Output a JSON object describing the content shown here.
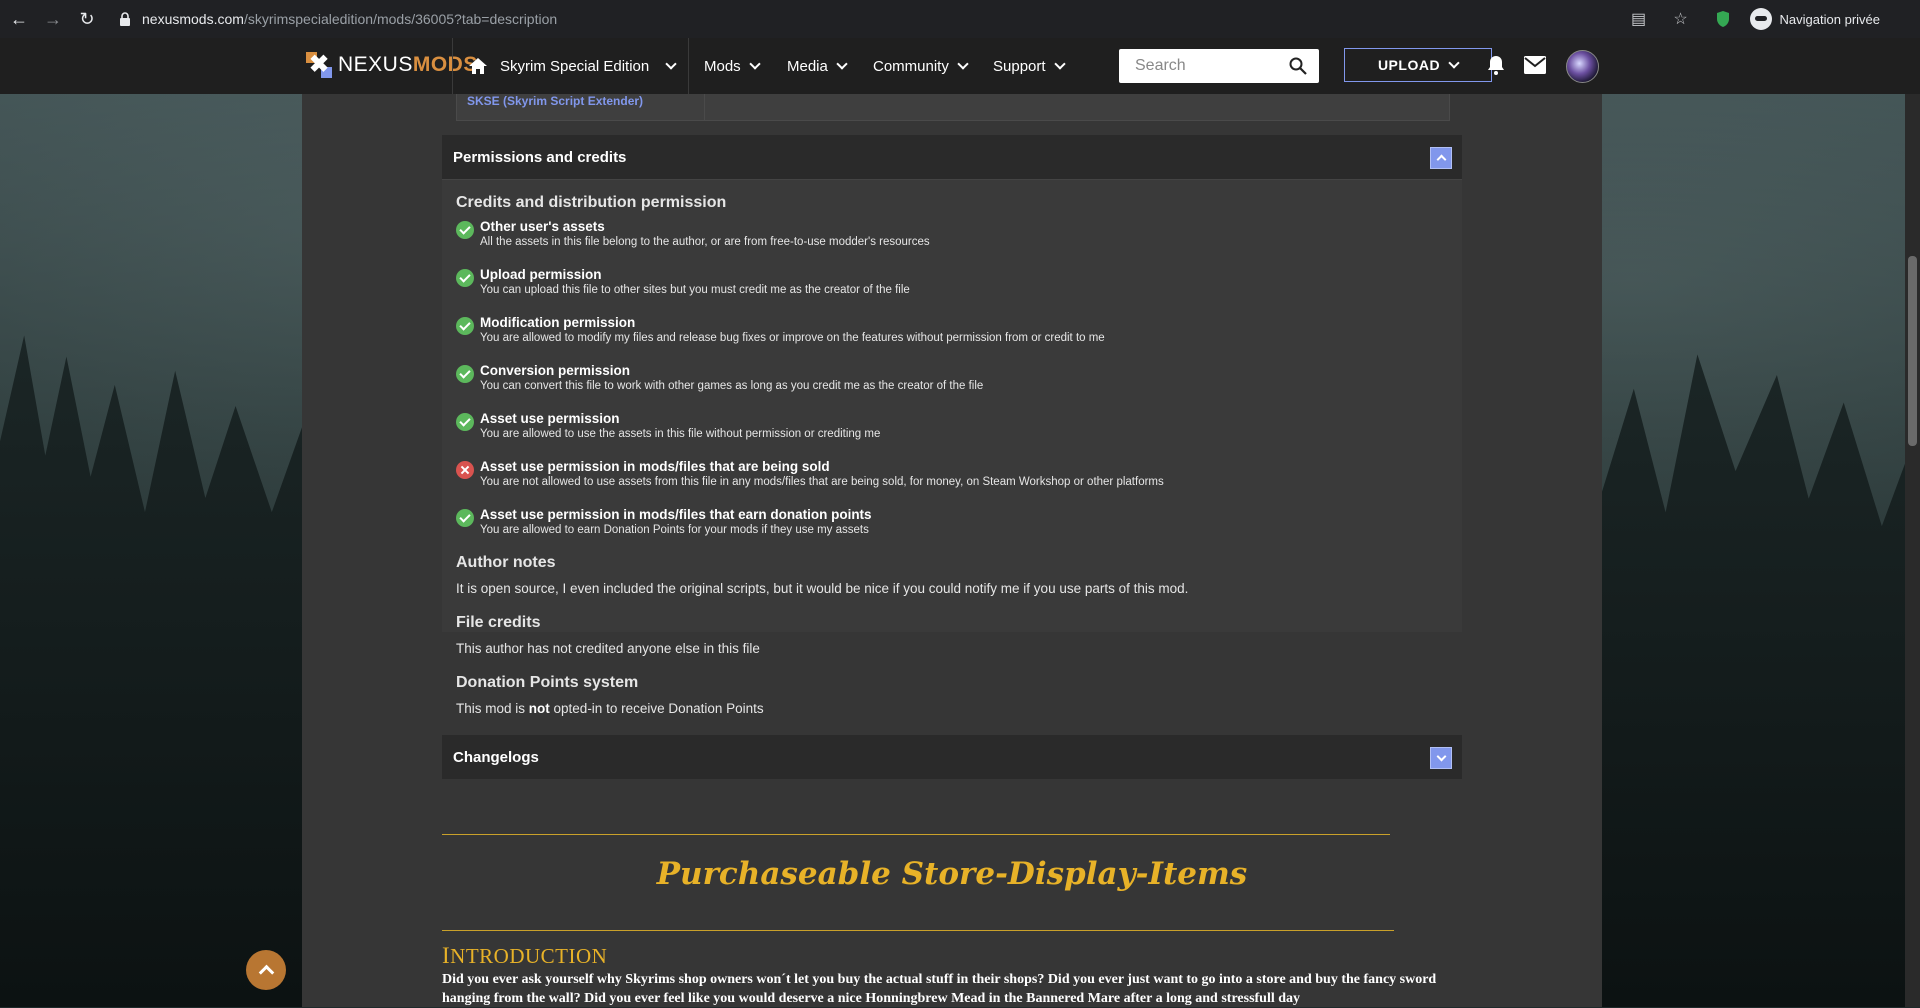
{
  "browser": {
    "url_host": "nexusmods.com",
    "url_path": "/skyrimspecialedition/mods/36005?tab=description",
    "profile_label": "Navigation privée"
  },
  "nav": {
    "logo_part1": "NEXUS",
    "logo_part2": "MODS",
    "game": "Skyrim Special Edition",
    "items": [
      "Mods",
      "Media",
      "Community",
      "Support"
    ],
    "search_placeholder": "Search",
    "upload_label": "UPLOAD"
  },
  "requirements": {
    "link": "SKSE (Skyrim Script Extender)"
  },
  "permissions": {
    "panel_title": "Permissions and credits",
    "credits_heading": "Credits and distribution permission",
    "items": [
      {
        "title": "Other user's assets",
        "desc": "All the assets in this file belong to the author, or are from free-to-use modder's resources",
        "status": "allowed"
      },
      {
        "title": "Upload permission",
        "desc": "You can upload this file to other sites but you must credit me as the creator of the file",
        "status": "allowed"
      },
      {
        "title": "Modification permission",
        "desc": "You are allowed to modify my files and release bug fixes or improve on the features without permission from or credit to me",
        "status": "allowed"
      },
      {
        "title": "Conversion permission",
        "desc": "You can convert this file to work with other games as long as you credit me as the creator of the file",
        "status": "allowed"
      },
      {
        "title": "Asset use permission",
        "desc": "You are allowed to use the assets in this file without permission or crediting me",
        "status": "allowed"
      },
      {
        "title": "Asset use permission in mods/files that are being sold",
        "desc": "You are not allowed to use assets from this file in any mods/files that are being sold, for money, on Steam Workshop or other platforms",
        "status": "denied"
      },
      {
        "title": "Asset use permission in mods/files that earn donation points",
        "desc": "You are allowed to earn Donation Points for your mods if they use my assets",
        "status": "allowed"
      }
    ],
    "author_notes_heading": "Author notes",
    "author_notes": "It is open source, I even included the original scripts, but it would be nice if you could notify me if you use parts of this mod.",
    "file_credits_heading": "File credits",
    "file_credits": "This author has not credited anyone else in this file",
    "donation_heading": "Donation Points system",
    "donation_pre": "This mod is ",
    "donation_bold": "not",
    "donation_post": " opted-in to receive Donation Points"
  },
  "changelogs": {
    "panel_title": "Changelogs"
  },
  "description": {
    "title": "Purchaseable Store-Display-Items",
    "intro_first": "I",
    "intro_rest": "NTRODUCTION",
    "text": "Did you ever ask yourself why Skyrims shop owners won´t let you buy the actual stuff in their shops? Did you ever just want to go into a store and buy the fancy sword hanging from the wall? Did you ever feel like you would deserve a nice Honningbrew Mead in the Bannered Mare after a long and stressfull day"
  },
  "colors": {
    "accent_blue": "#8197ec",
    "accent_orange": "#d98f40",
    "gold": "#e8b228",
    "allowed": "#5cb85c",
    "denied": "#d9534f"
  }
}
